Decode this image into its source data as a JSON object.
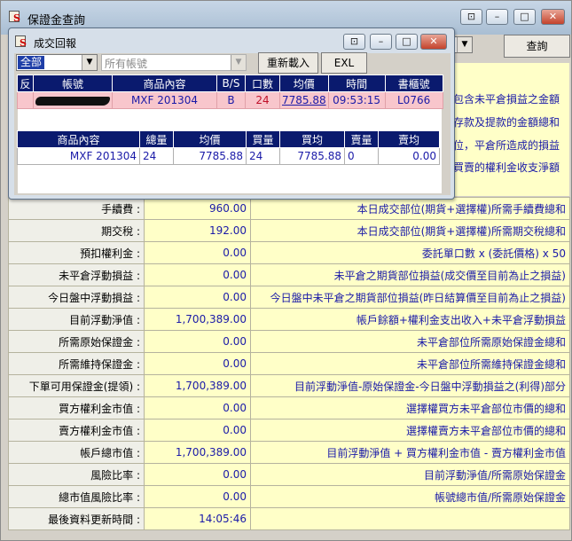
{
  "main": {
    "title": "保證金查詢",
    "query_button": "查詢",
    "right_partial": [
      "包含未平倉損益之金額",
      "存款及提款的金額總和",
      "位，平倉所造成的損益",
      "買賣的權利金收支淨額"
    ],
    "rows": [
      {
        "label": "手續費 :",
        "value": "960.00",
        "desc": "本日成交部位(期貨+選擇權)所需手續費總和"
      },
      {
        "label": "期交稅 :",
        "value": "192.00",
        "desc": "本日成交部位(期貨+選擇權)所需期交稅總和"
      },
      {
        "label": "預扣權利金 :",
        "value": "0.00",
        "desc": "委託單口數 x (委託價格) x 50"
      },
      {
        "label": "未平倉浮動損益 :",
        "value": "0.00",
        "desc": "未平倉之期貨部位損益(成交價至目前為止之損益)"
      },
      {
        "label": "今日盤中浮動損益 :",
        "value": "0.00",
        "desc": "今日盤中未平倉之期貨部位損益(昨日結算價至目前為止之損益)"
      },
      {
        "label": "目前浮動淨值 :",
        "value": "1,700,389.00",
        "desc": "帳戶餘額+權利金支出收入+未平倉浮動損益"
      },
      {
        "label": "所需原始保證金 :",
        "value": "0.00",
        "desc": "未平倉部位所需原始保證金總和"
      },
      {
        "label": "所需維持保證金 :",
        "value": "0.00",
        "desc": "未平倉部位所需維持保證金總和"
      },
      {
        "label": "下單可用保證金(提領) :",
        "value": "1,700,389.00",
        "desc": "目前浮動淨值-原始保證金-今日盤中浮動損益之(利得)部分"
      },
      {
        "label": "買方權利金市值 :",
        "value": "0.00",
        "desc": "選擇權買方未平倉部位市價的總和"
      },
      {
        "label": "賣方權利金市值 :",
        "value": "0.00",
        "desc": "選擇權賣方未平倉部位市價的總和"
      },
      {
        "label": "帳戶總市值 :",
        "value": "1,700,389.00",
        "desc": "目前浮動淨值 + 買方權利金市值 - 賣方權利金市值"
      },
      {
        "label": "風險比率 :",
        "value": "0.00",
        "desc": "目前浮動淨值/所需原始保證金"
      },
      {
        "label": "總市值風險比率 :",
        "value": "0.00",
        "desc": "帳號總市值/所需原始保證金"
      },
      {
        "label": "最後資料更新時間 :",
        "value": "14:05:46",
        "desc": ""
      }
    ]
  },
  "popup": {
    "title": "成交回報",
    "filter_value": "全部",
    "account_placeholder": "所有帳號",
    "reload_button": "重新載入",
    "excel_button": "EXL",
    "fills_headers": [
      "反",
      "帳號",
      "商品內容",
      "B/S",
      "口數",
      "均價",
      "時間",
      "書櫃號"
    ],
    "fills_row": {
      "product": "MXF 201304",
      "side": "B",
      "qty": "24",
      "avg": "7785.88",
      "time": "09:53:15",
      "book": "L0766"
    },
    "summary_headers": [
      "商品內容",
      "總量",
      "均價",
      "買量",
      "買均",
      "賣量",
      "賣均"
    ],
    "summary_row": {
      "product": "MXF 201304",
      "total": "24",
      "avg": "7785.88",
      "buy_qty": "24",
      "buy_avg": "7785.88",
      "sell_qty": "0",
      "sell_avg": "0.00"
    }
  }
}
